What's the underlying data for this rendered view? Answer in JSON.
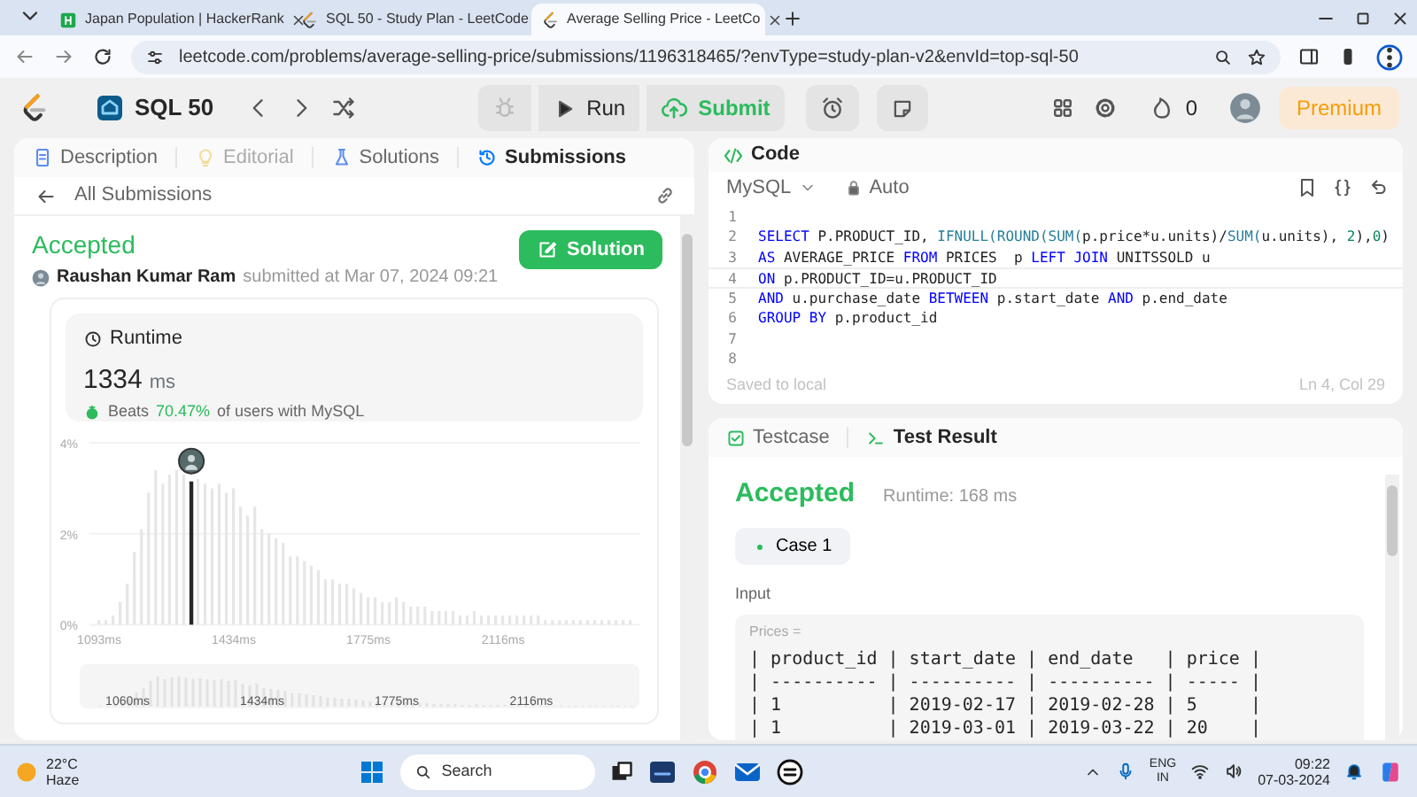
{
  "browser": {
    "tabs": [
      {
        "title": "Japan Population | HackerRank",
        "selected": false,
        "kind": "hackerrank"
      },
      {
        "title": "SQL 50 - Study Plan - LeetCode",
        "selected": false,
        "kind": "leetcode"
      },
      {
        "title": "Average Selling Price - LeetCo",
        "selected": true,
        "kind": "leetcode"
      }
    ],
    "url": "leetcode.com/problems/average-selling-price/submissions/1196318465/?envType=study-plan-v2&envId=top-sql-50"
  },
  "toolbar": {
    "study_plan": "SQL 50",
    "run": "Run",
    "submit": "Submit",
    "streak": "0",
    "premium": "Premium"
  },
  "left_tabs": [
    {
      "label": "Description",
      "selected": false,
      "disabled": false,
      "kind": "doc"
    },
    {
      "label": "Editorial",
      "selected": false,
      "disabled": true,
      "kind": "bulb"
    },
    {
      "label": "Solutions",
      "selected": false,
      "disabled": false,
      "kind": "flask"
    },
    {
      "label": "Submissions",
      "selected": true,
      "disabled": false,
      "kind": "history"
    }
  ],
  "back_link": "All Submissions",
  "submission": {
    "status": "Accepted",
    "author": "Raushan Kumar Ram",
    "submitted": "submitted at Mar 07, 2024 09:21",
    "solution_button": "Solution",
    "runtime": {
      "label": "Runtime",
      "value": "1334",
      "unit": "ms",
      "beats_prefix": "Beats",
      "beats_percent": "70.47%",
      "beats_suffix": "of users with MySQL"
    },
    "chart_data": {
      "type": "bar",
      "stacked": true,
      "xlim": [
        1072,
        2467
      ],
      "ylim": [
        0,
        4
      ],
      "yticks": [
        {
          "value": 0,
          "label": "0%"
        },
        {
          "value": 2,
          "label": "2%"
        },
        {
          "value": 4,
          "label": "4%"
        }
      ],
      "x": [
        1093,
        1111,
        1129,
        1147,
        1165,
        1183,
        1201,
        1219,
        1237,
        1255,
        1272,
        1290,
        1308,
        1326,
        1344,
        1362,
        1380,
        1398,
        1416,
        1434,
        1452,
        1470,
        1488,
        1506,
        1524,
        1542,
        1560,
        1578,
        1596,
        1614,
        1631,
        1649,
        1667,
        1685,
        1703,
        1721,
        1739,
        1757,
        1775,
        1793,
        1811,
        1829,
        1847,
        1865,
        1883,
        1901,
        1919,
        1937,
        1955,
        1972,
        1990,
        2008,
        2026,
        2044,
        2062,
        2080,
        2098,
        2116,
        2134,
        2152,
        2170,
        2188,
        2206,
        2224,
        2242,
        2260,
        2277,
        2295,
        2313,
        2331,
        2349,
        2367,
        2385,
        2403,
        2421,
        2439
      ],
      "xticks": [
        {
          "value": 1093,
          "label": "1093ms"
        },
        {
          "value": 1434,
          "label": "1434ms"
        },
        {
          "value": 1775,
          "label": "1775ms"
        },
        {
          "value": 2116,
          "label": "2116ms"
        }
      ],
      "series": [
        {
          "color": "#e6e6e6",
          "values": [
            0.1,
            0.1,
            0.2,
            0.5,
            0.9,
            1.6,
            2.1,
            2.9,
            3.4,
            3.1,
            3.3,
            3.4,
            3.3,
            null,
            3.2,
            3.1,
            3.0,
            3.1,
            2.9,
            3.0,
            2.6,
            2.4,
            2.6,
            2.1,
            2.0,
            1.9,
            1.8,
            1.5,
            1.5,
            1.4,
            1.3,
            1.2,
            1.0,
            1.0,
            0.9,
            0.9,
            0.8,
            0.7,
            0.6,
            0.6,
            0.5,
            0.5,
            0.6,
            0.5,
            0.4,
            0.4,
            0.4,
            0.3,
            0.3,
            0.3,
            0.3,
            0.2,
            0.2,
            0.3,
            0.2,
            0.2,
            0.2,
            0.2,
            0.2,
            0.2,
            0.2,
            0.2,
            0.2,
            0.1,
            0.1,
            0.1,
            0.1,
            0.1,
            0.1,
            0.1,
            0.1,
            0.1,
            0.1,
            0.1,
            0.1,
            0.1
          ]
        },
        {
          "color": "#262626",
          "values": [
            null,
            null,
            null,
            null,
            null,
            null,
            null,
            null,
            null,
            null,
            null,
            null,
            null,
            3.15,
            null,
            null,
            null,
            null,
            null,
            null,
            null,
            null,
            null,
            null,
            null,
            null,
            null,
            null,
            null,
            null,
            null,
            null,
            null,
            null,
            null,
            null,
            null,
            null,
            null,
            null,
            null,
            null,
            null,
            null,
            null,
            null,
            null,
            null,
            null,
            null,
            null,
            null,
            null,
            null,
            null,
            null,
            null,
            null,
            null,
            null,
            null,
            null,
            null,
            null,
            null,
            null,
            null,
            null,
            null,
            null,
            null,
            null,
            null,
            null,
            null,
            null
          ]
        }
      ]
    },
    "navigator_labels": [
      "1060ms",
      "1434ms",
      "1775ms",
      "2116ms"
    ]
  },
  "editor": {
    "title": "Code",
    "language": "MySQL",
    "mode": "Auto",
    "saved": "Saved to local",
    "cursor": "Ln 4, Col 29",
    "lines": [
      {
        "number": "1",
        "current": false
      },
      {
        "number": "2",
        "current": false,
        "tokens": [
          {
            "kind": "kw",
            "text": "SELECT"
          },
          {
            "kind": "txt",
            "text": " P.PRODUCT_ID, "
          },
          {
            "kind": "fn",
            "text": "IFNULL(ROUND(SUM("
          },
          {
            "kind": "txt",
            "text": "p.price*u.units)/"
          },
          {
            "kind": "fn",
            "text": "SUM("
          },
          {
            "kind": "txt",
            "text": "u.units), "
          },
          {
            "kind": "num",
            "text": "2"
          },
          {
            "kind": "txt",
            "text": "),"
          },
          {
            "kind": "num",
            "text": "0"
          },
          {
            "kind": "txt",
            "text": ")"
          }
        ]
      },
      {
        "number": "3",
        "current": false,
        "tokens": [
          {
            "kind": "kw",
            "text": "AS"
          },
          {
            "kind": "txt",
            "text": " AVERAGE_PRICE "
          },
          {
            "kind": "kw",
            "text": "FROM"
          },
          {
            "kind": "txt",
            "text": " PRICES  p "
          },
          {
            "kind": "kw",
            "text": "LEFT JOIN"
          },
          {
            "kind": "txt",
            "text": " UNITSSOLD u"
          }
        ]
      },
      {
        "number": "4",
        "current": true,
        "tokens": [
          {
            "kind": "kw",
            "text": "ON"
          },
          {
            "kind": "txt",
            "text": " p.PRODUCT_ID=u.PRODUCT_ID"
          }
        ]
      },
      {
        "number": "5",
        "current": false,
        "tokens": [
          {
            "kind": "kw",
            "text": "AND"
          },
          {
            "kind": "txt",
            "text": " u.purchase_date "
          },
          {
            "kind": "kw",
            "text": "BETWEEN"
          },
          {
            "kind": "txt",
            "text": " p.start_date "
          },
          {
            "kind": "kw",
            "text": "AND"
          },
          {
            "kind": "txt",
            "text": " p.end_date"
          }
        ]
      },
      {
        "number": "6",
        "current": false,
        "tokens": [
          {
            "kind": "kw",
            "text": "GROUP BY"
          },
          {
            "kind": "txt",
            "text": " p.product_id"
          }
        ]
      },
      {
        "number": "7",
        "current": false
      },
      {
        "number": "8",
        "current": false
      }
    ]
  },
  "result": {
    "tabs": [
      {
        "label": "Testcase",
        "selected": false,
        "kind": "check"
      },
      {
        "label": "Test Result",
        "selected": true,
        "kind": "terminal"
      }
    ],
    "status": "Accepted",
    "runtime": "Runtime: 168 ms",
    "case": "Case 1",
    "input_label": "Input",
    "table_name": "Prices =",
    "table_lines": [
      "| product_id | start_date | end_date   | price |",
      "| ---------- | ---------- | ---------- | ----- |",
      "| 1          | 2019-02-17 | 2019-02-28 | 5     |",
      "| 1          | 2019-03-01 | 2019-03-22 | 20    |"
    ]
  },
  "taskbar": {
    "temperature": "22°C",
    "weather": "Haze",
    "search": "Search",
    "language": "ENG",
    "region": "IN",
    "time": "09:22",
    "date": "07-03-2024"
  }
}
